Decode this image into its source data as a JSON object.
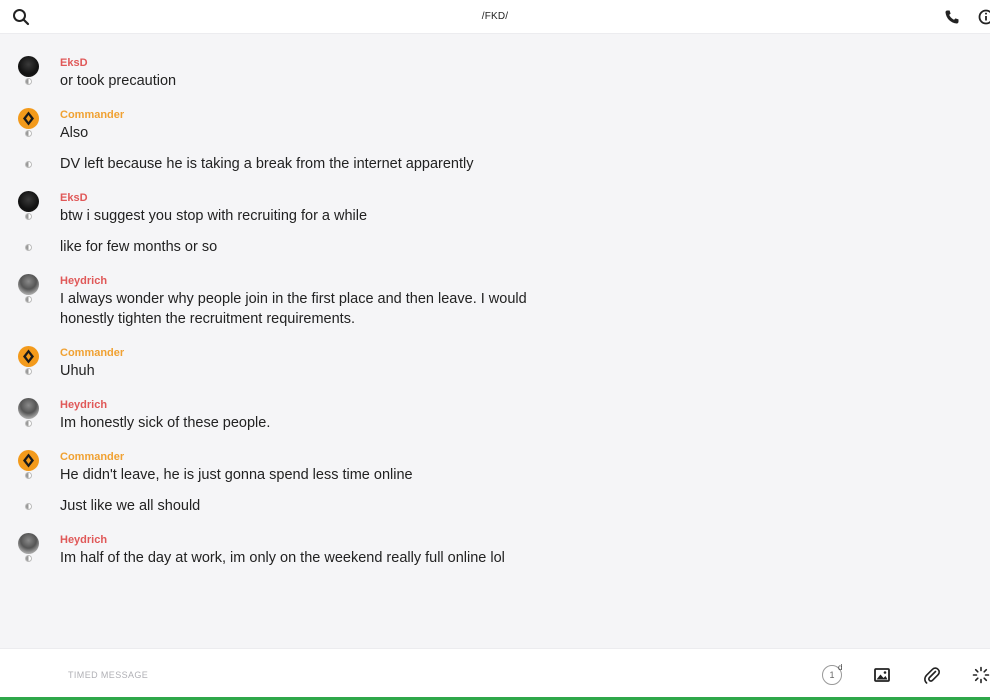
{
  "header": {
    "title": "/FKD/"
  },
  "messages": [
    {
      "sender": "EksD",
      "color": "#e05858",
      "avatar": "eksd",
      "text": "or took precaution",
      "group": true
    },
    {
      "sender": "Commander",
      "color": "#f0a132",
      "avatar": "commander",
      "text": "Also",
      "group": true
    },
    {
      "sender": "Commander",
      "text": "DV left because he is taking a break from the internet apparently",
      "group": false
    },
    {
      "sender": "EksD",
      "color": "#e05858",
      "avatar": "eksd",
      "text": "btw i suggest you stop with recruiting for a while",
      "group": true
    },
    {
      "sender": "EksD",
      "text": "like for few months or so",
      "group": false
    },
    {
      "sender": "Heydrich",
      "color": "#e05858",
      "avatar": "heydrich",
      "text": "I always wonder why people join in the first place and then leave. I would honestly tighten the recruitment requirements.",
      "group": true
    },
    {
      "sender": "Commander",
      "color": "#f0a132",
      "avatar": "commander",
      "text": "Uhuh",
      "group": true
    },
    {
      "sender": "Heydrich",
      "color": "#e05858",
      "avatar": "heydrich",
      "text": "Im honestly sick of these people.",
      "group": true
    },
    {
      "sender": "Commander",
      "color": "#f0a132",
      "avatar": "commander",
      "text": "He didn't leave, he is just gonna spend less time online",
      "group": true
    },
    {
      "sender": "Commander",
      "text": "Just like we all should",
      "group": false
    },
    {
      "sender": "Heydrich",
      "color": "#e05858",
      "avatar": "heydrich",
      "text": "Im half of the day at work, im only on the weekend really full online lol",
      "group": true
    }
  ],
  "composer": {
    "placeholder": "TIMED MESSAGE",
    "timer_value": "1",
    "timer_unit": "d"
  },
  "icons": {
    "search": "search-icon",
    "phone": "phone-icon",
    "info": "info-icon",
    "image": "image-icon",
    "attach": "paperclip-icon",
    "ping": "ping-icon"
  },
  "colors": {
    "red_name": "#e05858",
    "orange_name": "#f0a132",
    "bottom_accent": "#2ea84a"
  }
}
